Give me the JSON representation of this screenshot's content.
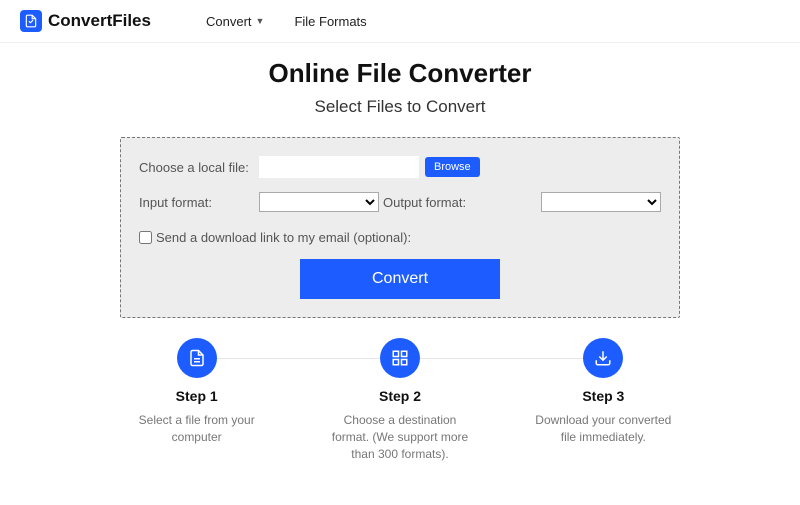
{
  "brand": "ConvertFiles",
  "nav": {
    "convert": "Convert",
    "formats": "File Formats"
  },
  "hero": {
    "title": "Online File Converter",
    "subtitle": "Select Files to Convert"
  },
  "form": {
    "choose_label": "Choose a local file:",
    "browse": "Browse",
    "input_format_label": "Input format:",
    "output_format_label": "Output format:",
    "email_label": "Send a download link to my email (optional):",
    "convert": "Convert"
  },
  "steps": [
    {
      "title": "Step 1",
      "desc": "Select a file from your computer"
    },
    {
      "title": "Step 2",
      "desc": "Choose a destination format. (We support more than 300 formats)."
    },
    {
      "title": "Step 3",
      "desc": "Download your converted file immediately."
    }
  ]
}
